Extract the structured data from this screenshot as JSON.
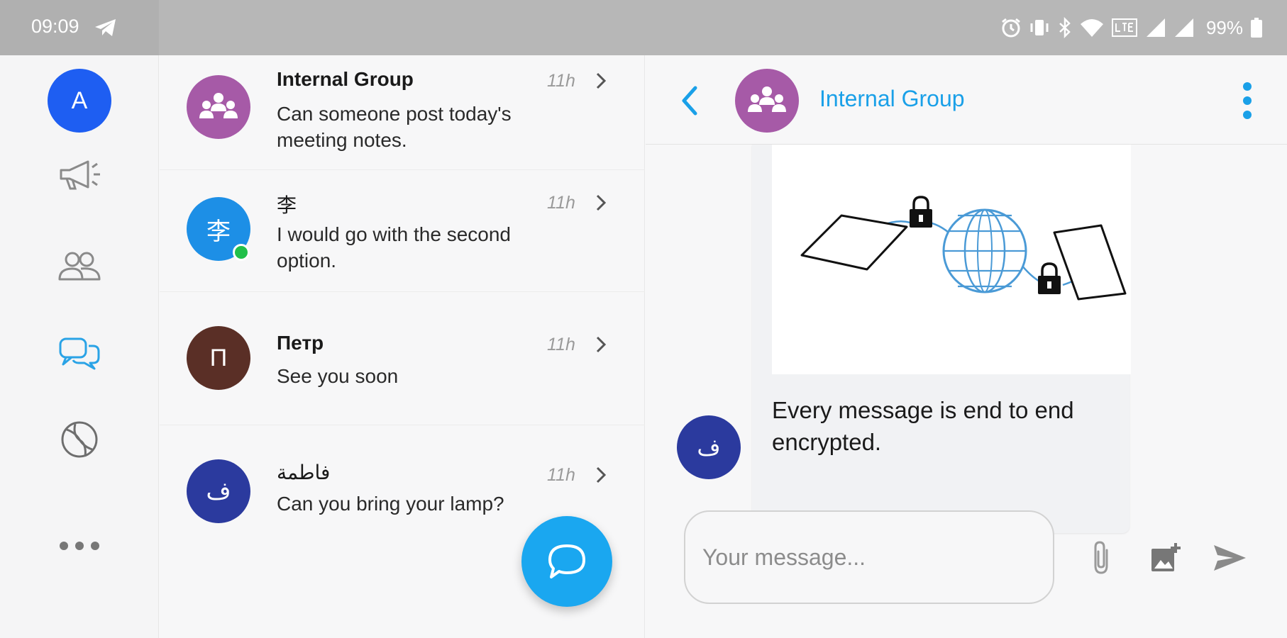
{
  "status_bar": {
    "time": "09:09",
    "battery": "99%",
    "icons": [
      "telegram-icon",
      "alarm-icon",
      "vibrate-icon",
      "bluetooth-icon",
      "wifi-icon",
      "lte-icon",
      "signal-icon",
      "signal-icon",
      "battery-icon"
    ]
  },
  "rail": {
    "avatar_letter": "A",
    "items": [
      {
        "icon": "megaphone-icon"
      },
      {
        "icon": "contacts-icon"
      },
      {
        "icon": "chats-icon",
        "active": true
      },
      {
        "icon": "globe-icon"
      },
      {
        "icon": "more-icon"
      }
    ]
  },
  "conversations": [
    {
      "name": "Internal Group",
      "message": "Can someone post today's meeting notes.",
      "time": "11h",
      "avatar_color": "#a65aa7",
      "icon": "group-icon"
    },
    {
      "name": "李",
      "message": "I would go with the second option.",
      "time": "11h",
      "avatar_color": "#1d8fe6",
      "avatar_text": "李",
      "online": true
    },
    {
      "name": "Петр",
      "message": "See you soon",
      "time": "11h",
      "avatar_color": "#5a2f26",
      "avatar_text": "П"
    },
    {
      "name": "فاطمة",
      "message": "Can you bring your lamp?",
      "time": "11h",
      "avatar_color": "#2b3a9e",
      "avatar_text": "ف"
    }
  ],
  "chat": {
    "title": "Internal Group",
    "message_text": "Every message is end to end encrypted.",
    "sender_avatar_text": "ف",
    "composer_placeholder": "Your message..."
  },
  "colors": {
    "accent": "#1aa0e8",
    "fab": "#1aa7f0",
    "rail_avatar": "#1e5ef2"
  }
}
